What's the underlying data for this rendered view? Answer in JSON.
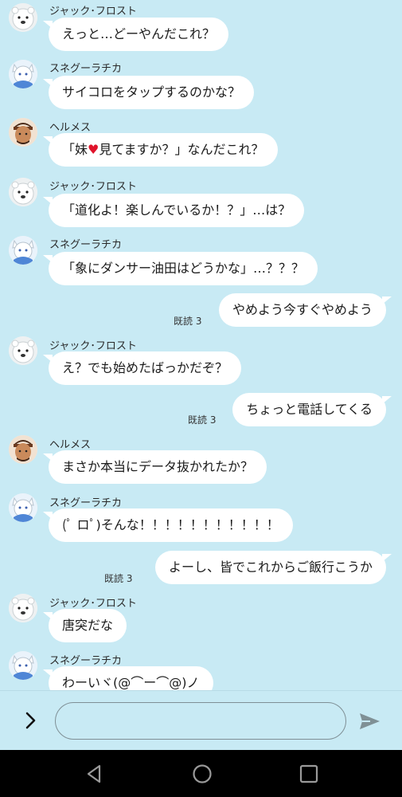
{
  "chat": {
    "messages": [
      {
        "type": "in",
        "avatar": "polar-bear",
        "name": "ジャック･フロスト",
        "text": "えっと…どーやんだこれ？"
      },
      {
        "type": "in",
        "avatar": "white-fox",
        "name": "スネグーラチカ",
        "text": "サイコロをタップするのかな？"
      },
      {
        "type": "in",
        "avatar": "man",
        "name": "ヘルメス",
        "text_before": "「妹",
        "heart": "♥",
        "text_after": "見てますか？」なんだこれ？"
      },
      {
        "type": "in",
        "avatar": "polar-bear",
        "name": "ジャック･フロスト",
        "text": "「道化よ！楽しんでいるか！？」…は？"
      },
      {
        "type": "in",
        "avatar": "white-fox",
        "name": "スネグーラチカ",
        "text": "「象にダンサー油田はどうかな」…？？？"
      },
      {
        "type": "out",
        "text": "やめよう今すぐやめよう",
        "read": "既読 3"
      },
      {
        "type": "in",
        "avatar": "polar-bear",
        "name": "ジャック･フロスト",
        "text": "え？でも始めたばっかだぞ？"
      },
      {
        "type": "out",
        "text": "ちょっと電話してくる",
        "read": "既読 3"
      },
      {
        "type": "in",
        "avatar": "man",
        "name": "ヘルメス",
        "text": "まさか本当にデータ抜かれたか？"
      },
      {
        "type": "in",
        "avatar": "white-fox",
        "name": "スネグーラチカ",
        "text": "(ﾟ ロﾟ)そんな！！！！！！！！！！！"
      },
      {
        "type": "out",
        "text": "よーし、皆でこれからご飯行こうか",
        "read": "既読 3"
      },
      {
        "type": "in",
        "avatar": "polar-bear",
        "name": "ジャック･フロスト",
        "text": "唐突だな"
      },
      {
        "type": "in",
        "avatar": "white-fox",
        "name": "スネグーラチカ",
        "text": "わーいヾ(@⌒ー⌒@)ノ"
      }
    ]
  },
  "input": {
    "value": "",
    "placeholder": ""
  },
  "icons": {
    "expand": "chevron-right-icon",
    "send": "send-icon",
    "nav_back": "triangle-back-icon",
    "nav_home": "circle-home-icon",
    "nav_recent": "square-recent-icon"
  },
  "colors": {
    "background": "#c8eaf4",
    "bubble": "#ffffff",
    "heart": "#e0142b",
    "navbar": "#000000"
  }
}
